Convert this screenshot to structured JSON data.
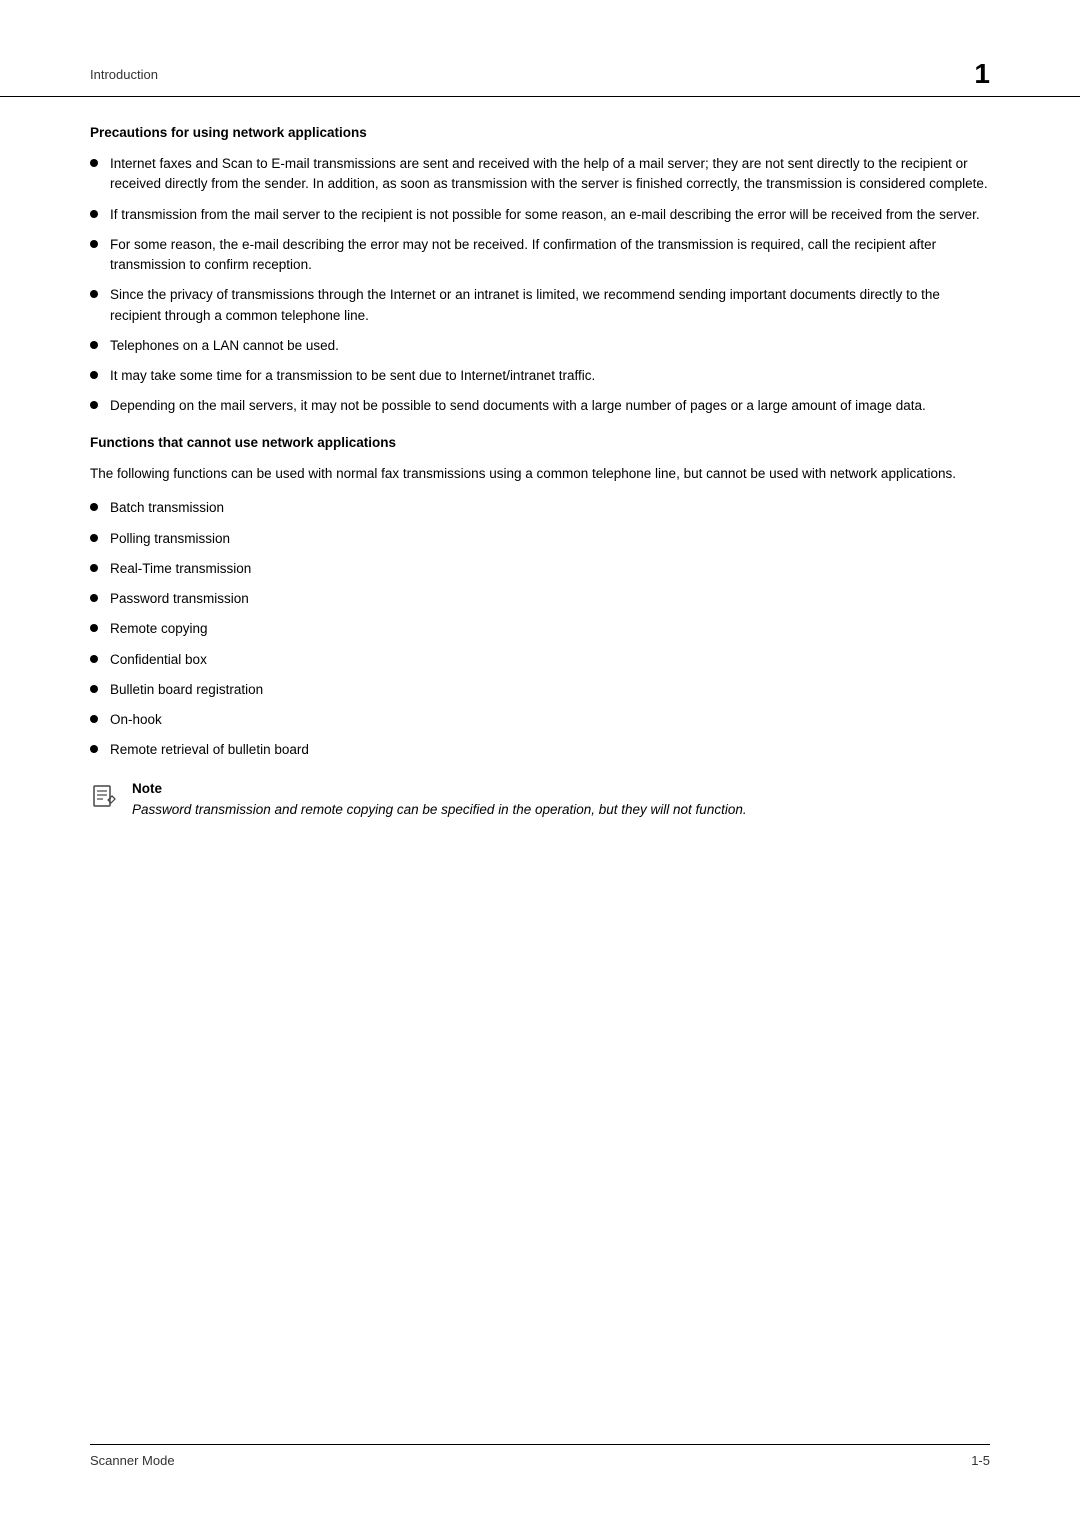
{
  "header": {
    "section_label": "Introduction",
    "page_number": "1"
  },
  "sections": {
    "precautions": {
      "title": "Precautions for using network applications",
      "bullets": [
        "Internet faxes and Scan to E-mail transmissions are sent and received with the help of a mail server; they are not sent directly to the recipient or received directly from the sender. In addition, as soon as transmission with the server is finished correctly, the transmission is considered complete.",
        "If transmission from the mail server to the recipient is not possible for some reason, an e-mail describing the error will be received from the server.",
        "For some reason, the e-mail describing the error may not be received. If confirmation of the transmission is required, call the recipient after transmission to confirm reception.",
        "Since the privacy of transmissions through the Internet or an intranet is limited, we recommend sending important documents directly to the recipient through a common telephone line.",
        "Telephones on a LAN cannot be used.",
        "It may take some time for a transmission to be sent due to Internet/intranet traffic.",
        "Depending on the mail servers, it may not be possible to send documents with a large number of pages or a large amount of image data."
      ]
    },
    "functions": {
      "title": "Functions that cannot use network applications",
      "intro": "The following functions can be used with normal fax transmissions using a common telephone line, but cannot be used with network applications.",
      "bullets": [
        "Batch transmission",
        "Polling transmission",
        "Real-Time transmission",
        "Password transmission",
        "Remote copying",
        "Confidential box",
        "Bulletin board registration",
        "On-hook",
        "Remote retrieval of bulletin board"
      ]
    },
    "note": {
      "label": "Note",
      "text": "Password transmission and remote copying can be specified in the operation, but they will not function."
    }
  },
  "footer": {
    "left": "Scanner Mode",
    "right": "1-5"
  }
}
